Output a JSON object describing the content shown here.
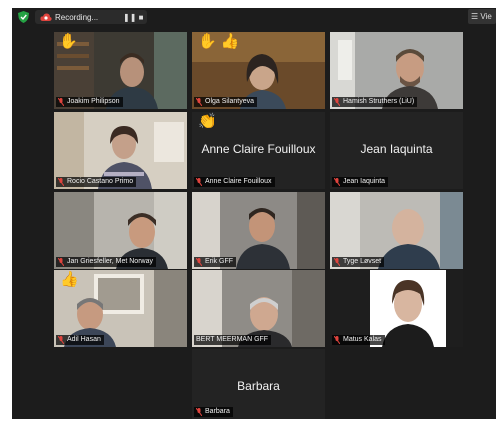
{
  "topbar": {
    "recording_label": "Recording...",
    "pause_symbol": "❚❚",
    "stop_symbol": "■",
    "view_label": "☰ Vie",
    "icons": [
      "shield-icon",
      "cloud-record-icon",
      "pause-icon",
      "stop-icon",
      "grid-view-icon"
    ]
  },
  "participants": [
    {
      "name": "Joakim Philipson",
      "reaction": "✋"
    },
    {
      "name": "Olga Silantyeva",
      "reaction": "✋ 👍"
    },
    {
      "name": "Hamish Struthers (LiU)"
    },
    {
      "name": "Rocio Castano Primo"
    },
    {
      "name": "Anne Claire Fouilloux",
      "display_name": "Anne Claire Fouilloux",
      "reaction": "👏"
    },
    {
      "name": "Jean Iaquinta",
      "display_name": "Jean Iaquinta"
    },
    {
      "name": "Jan Griesfeller, Met Norway"
    },
    {
      "name": "Erik GFF"
    },
    {
      "name": "Tyge Løvset"
    },
    {
      "name": "Adil Hasan",
      "reaction": "👍"
    },
    {
      "name": "BERT MEERMAN GFF"
    },
    {
      "name": "Matus Kalas"
    },
    {
      "name": "Barbara",
      "display_name": "Barbara"
    }
  ],
  "colors": {
    "window_bg": "#1c1c1c",
    "tile_bg": "#232323",
    "active_speaker_border": "#c4d24a",
    "muted_mic": "#e0443e",
    "recording_dot": "#e0443e",
    "shield": "#25a244"
  }
}
